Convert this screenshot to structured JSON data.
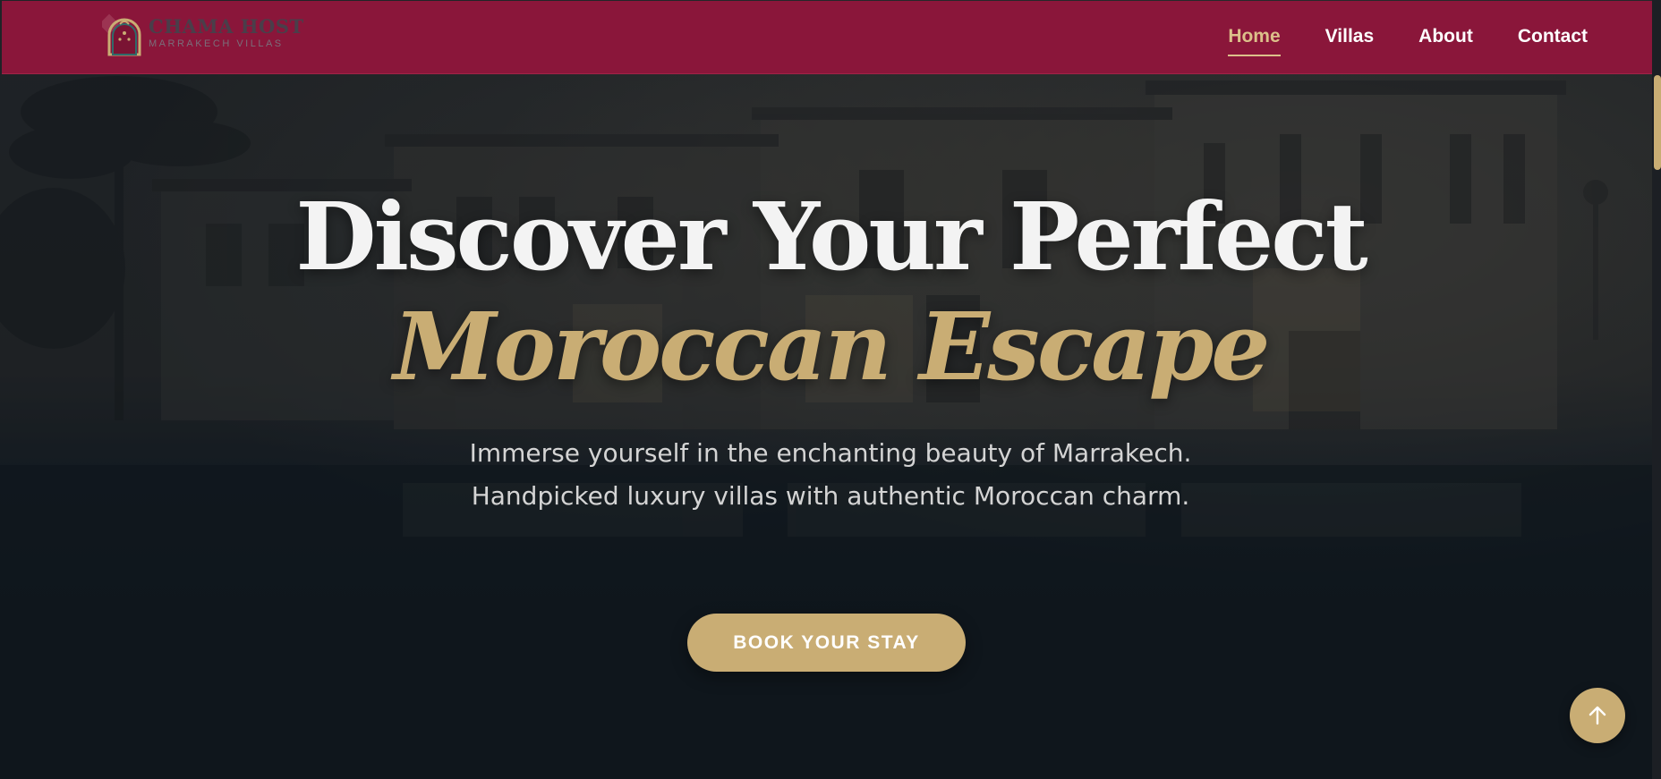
{
  "brand": {
    "name": "CHAMA HOST",
    "tagline": "MARRAKECH VILLAS"
  },
  "nav": {
    "items": [
      {
        "label": "Home",
        "active": true
      },
      {
        "label": "Villas",
        "active": false
      },
      {
        "label": "About",
        "active": false
      },
      {
        "label": "Contact",
        "active": false
      }
    ]
  },
  "hero": {
    "headline_line1": "Discover Your Perfect",
    "headline_line2": "Moroccan Escape",
    "subtitle": "Immerse yourself in the enchanting beauty of Marrakech. Handpicked luxury villas with authentic Moroccan charm.",
    "cta_label": "BOOK YOUR STAY"
  },
  "icons": {
    "logo": "moroccan-arch-icon",
    "back_to_top": "arrow-up-icon"
  },
  "colors": {
    "header_bg": "#8a163a",
    "accent_gold": "#c9ad74",
    "headline_white": "#f3f3f3",
    "hero_bg": "#151a21"
  }
}
